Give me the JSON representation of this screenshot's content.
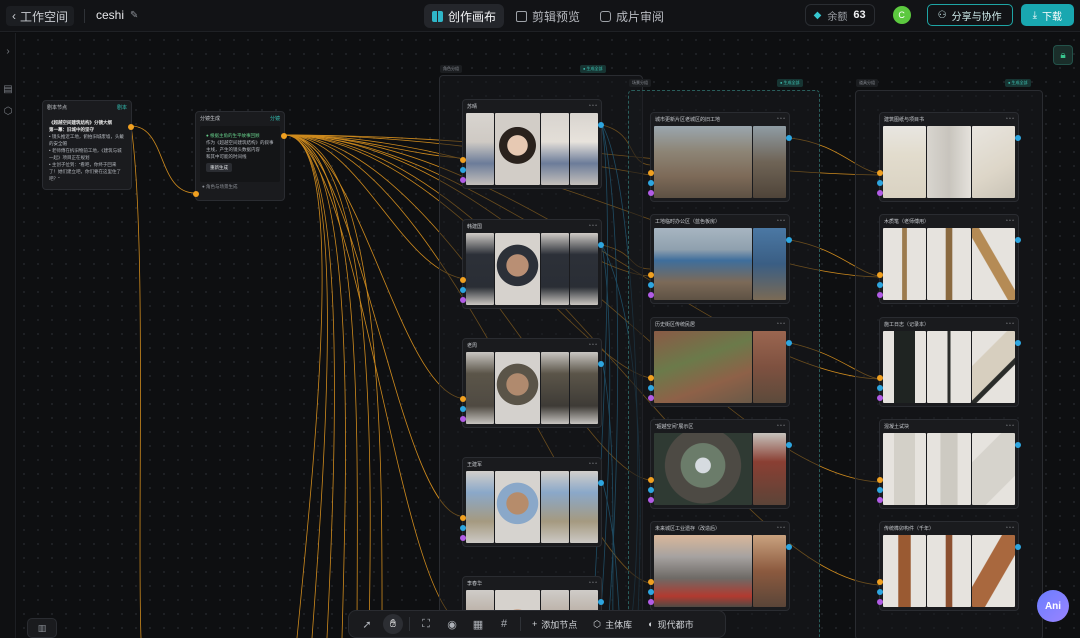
{
  "header": {
    "back_label": "工作空间",
    "project_name": "ceshi",
    "tabs": [
      {
        "label": "创作画布",
        "icon": "grid-icon",
        "active": true
      },
      {
        "label": "剪辑预览",
        "icon": "film-icon",
        "active": false
      },
      {
        "label": "成片审阅",
        "icon": "review-icon",
        "active": false
      }
    ],
    "balance_label": "余额",
    "balance_value": "63",
    "avatar_letter": "C",
    "share_label": "分享与协作",
    "download_label": "下载"
  },
  "colors": {
    "accent": "#19a7b0",
    "wire_orange": "#f0a020",
    "wire_blue": "#2ea6e0",
    "port_purple": "#b25ce6",
    "avatar_green": "#5cc93f"
  },
  "nodes": {
    "script_node": {
      "title": "剧本节点",
      "tag": "剧本",
      "lines": [
        "《超越空间建筑结构》分镜大纲",
        "第一幕：旧城中的坚守",
        "• 镜头推近工地，俯拍旧城废墟，头戴的安全帽",
        "• 老师傅在拆旧物前工地，《建筑与城一起》项目正在规划",
        "• 主创子位到：“看吧，你终于回来了！她们建立吧，你们要在这里住了吧？”"
      ]
    },
    "gen_node": {
      "title": "分镜生成",
      "tag": "分镜",
      "lines": [
        "● 根据主角的生平故事回顾",
        "作为《超越空间建筑结构》的叙事主线，产生的镜头数据内容",
        "和其中可能的时间线"
      ],
      "button": "重新生成",
      "footer": "● 角色与场景生成"
    }
  },
  "characters": [
    {
      "title": "苏晴"
    },
    {
      "title": "韩建国"
    },
    {
      "title": "老周"
    },
    {
      "title": "王建军"
    },
    {
      "title": "李春华"
    }
  ],
  "scenes": [
    {
      "title": "城市更新片区老城区的旧工地"
    },
    {
      "title": "工地临时办公区（蓝色板房）"
    },
    {
      "title": "历史街区传统民居"
    },
    {
      "title": "“超越空间”展示区"
    },
    {
      "title": "未来城区工业遗存（改造后）"
    }
  ],
  "props": [
    {
      "title": "建筑图纸与项目书"
    },
    {
      "title": "木质笔（老师傅用）"
    },
    {
      "title": "施工日志（记录本）"
    },
    {
      "title": "混凝土试块"
    },
    {
      "title": "传统榫卯构件（千年）"
    }
  ],
  "group_labels": {
    "characters": "角色分组",
    "scenes": "场景分组",
    "props": "道具分组",
    "badge": "● 生成全部"
  },
  "toolbar": {
    "add_node": "添加节点",
    "library": "主体库",
    "modern_city": "现代都市"
  },
  "assistant_label": "Ani"
}
